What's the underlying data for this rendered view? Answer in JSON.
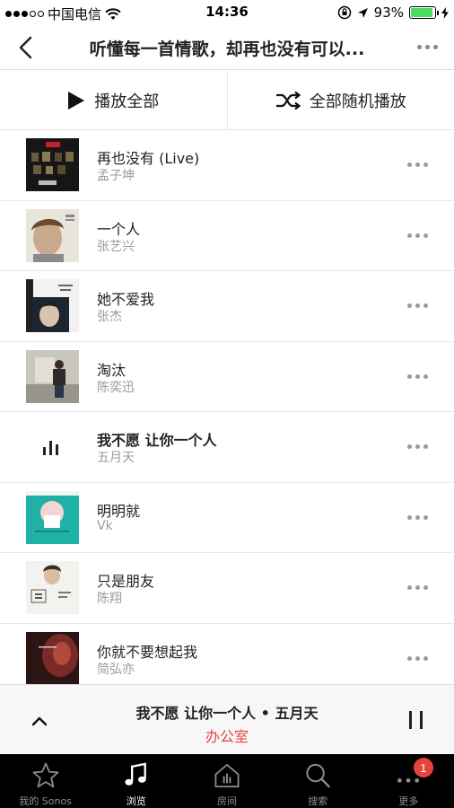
{
  "status_bar": {
    "carrier": "中国电信",
    "time": "14:36",
    "battery": "93%",
    "battery_level": 0.93
  },
  "header": {
    "title": "听懂每一首情歌，却再也没有可以..."
  },
  "actions": {
    "play_all": "播放全部",
    "shuffle_all": "全部随机播放"
  },
  "tracks": [
    {
      "title": "再也没有 (Live)",
      "artist": "孟子坤"
    },
    {
      "title": "一个人",
      "artist": "张艺兴"
    },
    {
      "title": "她不爱我",
      "artist": "张杰"
    },
    {
      "title": "淘汰",
      "artist": "陈奕迅"
    },
    {
      "title": "我不愿 让你一个人",
      "artist": "五月天"
    },
    {
      "title": "明明就",
      "artist": "Vk"
    },
    {
      "title": "只是朋友",
      "artist": "陈翔"
    },
    {
      "title": "你就不要想起我",
      "artist": "简弘亦"
    }
  ],
  "now_playing": {
    "track": "我不愿 让你一个人 • 五月天",
    "room": "办公室"
  },
  "tabs": [
    {
      "label": "我的 Sonos",
      "icon": "star-icon"
    },
    {
      "label": "浏览",
      "icon": "music-note-icon"
    },
    {
      "label": "房间",
      "icon": "room-icon"
    },
    {
      "label": "搜索",
      "icon": "search-icon"
    },
    {
      "label": "更多",
      "icon": "more-icon",
      "badge": "1"
    }
  ],
  "colors": {
    "accent": "#e8433a",
    "battery": "#4cd964",
    "tabbar": "#000000"
  }
}
